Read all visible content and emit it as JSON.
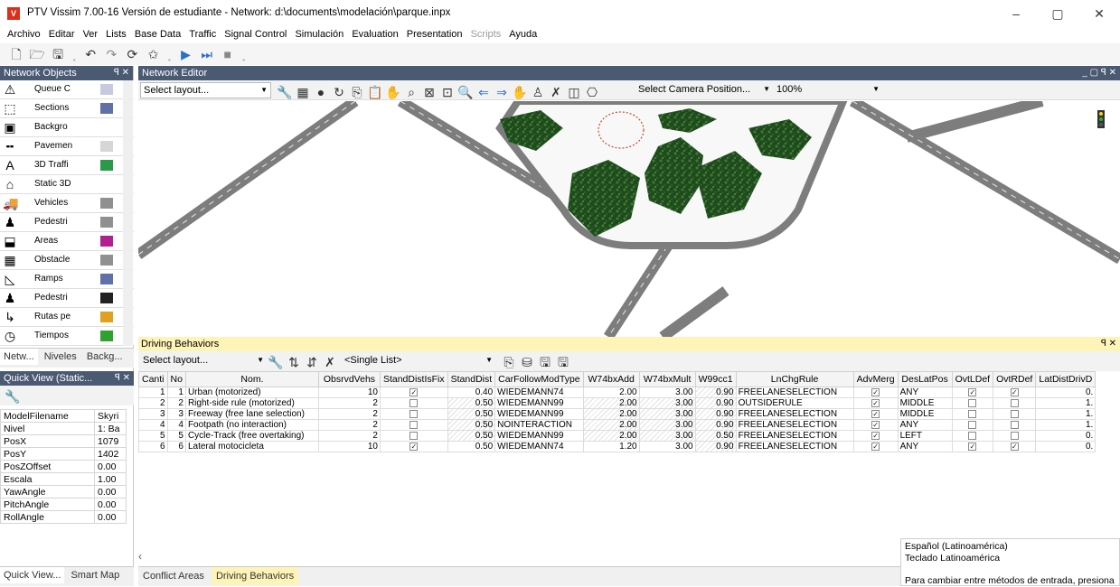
{
  "window": {
    "title": "PTV Vissim 7.00-16 Versión de estudiante - Network: d:\\documents\\modelación\\parque.inpx",
    "icon_text": "V",
    "minimize": "–",
    "maximize": "▢",
    "close": "✕"
  },
  "menu": [
    "Archivo",
    "Editar",
    "Ver",
    "Lists",
    "Base Data",
    "Traffic",
    "Signal Control",
    "Simulación",
    "Evaluation",
    "Presentation",
    "Scripts",
    "Ayuda"
  ],
  "network_objects": {
    "title": "Network Objects",
    "controls": "ꟼ ✕",
    "items": [
      {
        "label": "Queue C",
        "icon": "queue-counter-icon",
        "glyph": "⚠",
        "swatch": "#c8c8e0"
      },
      {
        "label": "Sections",
        "icon": "sections-icon",
        "glyph": "⬚",
        "swatch": "#6070a8"
      },
      {
        "label": "Backgro",
        "icon": "background-icon",
        "glyph": "▣",
        "swatch": ""
      },
      {
        "label": "Pavemen",
        "icon": "pavement-icon",
        "glyph": "╍",
        "swatch": "#d6d6d6"
      },
      {
        "label": "3D Traffi",
        "icon": "3d-traffic-icon",
        "glyph": "A",
        "swatch": "#2a9a4a"
      },
      {
        "label": "Static 3D",
        "icon": "static-3d-icon",
        "glyph": "⌂",
        "swatch": ""
      },
      {
        "label": "Vehicles",
        "icon": "vehicles-icon",
        "glyph": "🚚",
        "swatch": "#909090"
      },
      {
        "label": "Pedestri",
        "icon": "pedestrians-icon",
        "glyph": "♟",
        "swatch": "#909090"
      },
      {
        "label": "Areas",
        "icon": "areas-icon",
        "glyph": "⬓",
        "swatch": "#b02090"
      },
      {
        "label": "Obstacle",
        "icon": "obstacle-icon",
        "glyph": "▦",
        "swatch": "#909090"
      },
      {
        "label": "Ramps",
        "icon": "ramps-icon",
        "glyph": "◺",
        "swatch": "#6070a8"
      },
      {
        "label": "Pedestri",
        "icon": "pedestrian-routes-icon",
        "glyph": "♟",
        "swatch": "#222222"
      },
      {
        "label": "Rutas pe",
        "icon": "routes-icon",
        "glyph": "↳",
        "swatch": "#e0a020"
      },
      {
        "label": "Tiempos",
        "icon": "times-icon",
        "glyph": "◷",
        "swatch": "#30a030"
      }
    ]
  },
  "left_tabs": [
    "Netw...",
    "Niveles",
    "Backg..."
  ],
  "quick_view": {
    "title": "Quick View (Static...",
    "controls": "ꟼ ✕",
    "rows": [
      {
        "k": "ModelFilename",
        "v": "Skyri"
      },
      {
        "k": "Nivel",
        "v": "1: Ba"
      },
      {
        "k": "PosX",
        "v": "1079"
      },
      {
        "k": "PosY",
        "v": "1402"
      },
      {
        "k": "PosZOffset",
        "v": "0.00"
      },
      {
        "k": "Escala",
        "v": "1.00"
      },
      {
        "k": "YawAngle",
        "v": "0.00"
      },
      {
        "k": "PitchAngle",
        "v": "0.00"
      },
      {
        "k": "RollAngle",
        "v": "0.00"
      }
    ]
  },
  "quick_tabs": [
    "Quick View...",
    "Smart Map"
  ],
  "network_editor": {
    "title": "Network Editor",
    "controls": "_ ▢ ꟼ ✕",
    "layout_placeholder": "Select layout...",
    "camera_placeholder": "Select Camera Position...",
    "zoom": "100%"
  },
  "driving_behaviors": {
    "title": "Driving Behaviors",
    "controls": "ꟼ ✕",
    "layout_placeholder": "Select layout...",
    "list_mode": "<Single List>",
    "columns": [
      "Canti",
      "No",
      "Nom.",
      "ObsrvdVehs",
      "StandDistIsFix",
      "StandDist",
      "CarFollowModType",
      "W74bxAdd",
      "W74bxMult",
      "W99cc1",
      "LnChgRule",
      "AdvMerg",
      "DesLatPos",
      "OvtLDef",
      "OvtRDef",
      "LatDistDrivD"
    ],
    "rows": [
      {
        "c": "1",
        "no": "1",
        "nom": "Urban (motorized)",
        "obs": "10",
        "fix": true,
        "sd": "0.40",
        "cf": "WIEDEMANN74",
        "add": "2.00",
        "mult": "3.00",
        "cc1": "0.90",
        "ln": "FREELANESELECTION",
        "adv": true,
        "lat": "ANY",
        "ovl": true,
        "ovr": true,
        "ldd": "0."
      },
      {
        "c": "2",
        "no": "2",
        "nom": "Right-side rule (motorized)",
        "obs": "2",
        "fix": false,
        "sd": "0.50",
        "cf": "WIEDEMANN99",
        "add": "2.00",
        "mult": "3.00",
        "cc1": "0.90",
        "ln": "OUTSIDERULE",
        "adv": true,
        "lat": "MIDDLE",
        "ovl": false,
        "ovr": false,
        "ldd": "1."
      },
      {
        "c": "3",
        "no": "3",
        "nom": "Freeway (free lane selection)",
        "obs": "2",
        "fix": false,
        "sd": "0.50",
        "cf": "WIEDEMANN99",
        "add": "2.00",
        "mult": "3.00",
        "cc1": "0.90",
        "ln": "FREELANESELECTION",
        "adv": true,
        "lat": "MIDDLE",
        "ovl": false,
        "ovr": false,
        "ldd": "1."
      },
      {
        "c": "4",
        "no": "4",
        "nom": "Footpath (no interaction)",
        "obs": "2",
        "fix": false,
        "sd": "0.50",
        "cf": "NOINTERACTION",
        "add": "2.00",
        "mult": "3.00",
        "cc1": "0.90",
        "ln": "FREELANESELECTION",
        "adv": true,
        "lat": "ANY",
        "ovl": false,
        "ovr": false,
        "ldd": "1."
      },
      {
        "c": "5",
        "no": "5",
        "nom": "Cycle-Track (free overtaking)",
        "obs": "2",
        "fix": false,
        "sd": "0.50",
        "cf": "WIEDEMANN99",
        "add": "2.00",
        "mult": "3.00",
        "cc1": "0.50",
        "ln": "FREELANESELECTION",
        "adv": true,
        "lat": "LEFT",
        "ovl": false,
        "ovr": false,
        "ldd": "0."
      },
      {
        "c": "6",
        "no": "6",
        "nom": "Lateral motocicleta",
        "obs": "10",
        "fix": true,
        "sd": "0.50",
        "cf": "WIEDEMANN74",
        "add": "1.20",
        "mult": "3.00",
        "cc1": "0.90",
        "ln": "FREELANESELECTION",
        "adv": true,
        "lat": "ANY",
        "ovl": true,
        "ovr": true,
        "ldd": "0."
      }
    ]
  },
  "bottom_tabs": [
    "Conflict Areas",
    "Driving Behaviors"
  ],
  "ime_popup": {
    "lang": "Español (Latinoamérica)",
    "keyboard": "Teclado Latinoamérica",
    "hint": "Para cambiar entre métodos de entrada, presiona"
  }
}
